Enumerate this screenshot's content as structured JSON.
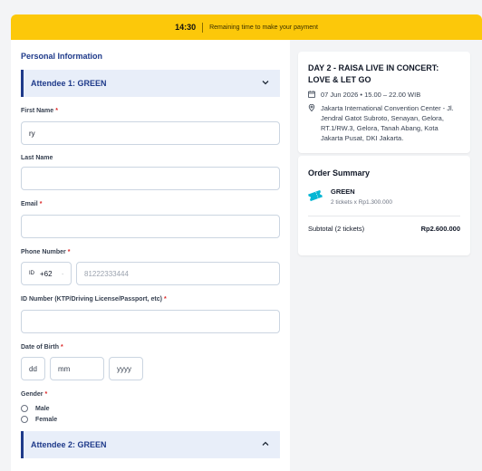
{
  "timer": {
    "time": "14:30",
    "message": "Remaining time to make your payment"
  },
  "form": {
    "section_title": "Personal Information",
    "attendee1": {
      "header": "Attendee 1: GREEN",
      "first_name_label": "First Name",
      "first_name_value": "ry",
      "last_name_label": "Last Name",
      "last_name_value": "",
      "email_label": "Email",
      "email_value": "",
      "phone_label": "Phone Number",
      "phone_flag": "ID",
      "phone_code": "+62",
      "phone_placeholder": "81222333444",
      "id_label": "ID Number (KTP/Driving License/Passport, etc)",
      "dob_label": "Date of Birth",
      "dob_day_placeholder": "dd",
      "dob_month_placeholder": "mm",
      "dob_year_placeholder": "yyyy",
      "gender_label": "Gender",
      "gender_options": [
        "Male",
        "Female"
      ]
    },
    "attendee2": {
      "header": "Attendee 2: GREEN"
    }
  },
  "event": {
    "title": "DAY 2 - RAISA LIVE IN CONCERT: LOVE & LET GO",
    "datetime": "07 Jun 2026 • 15.00 – 22.00 WIB",
    "location": "Jakarta International Convention Center - Jl. Jendral Gatot Subroto, Senayan, Gelora, RT.1/RW.3, Gelora, Tanah Abang, Kota Jakarta Pusat, DKI Jakarta."
  },
  "summary": {
    "title": "Order Summary",
    "ticket_name": "GREEN",
    "ticket_detail": "2 tickets x Rp1.300.000",
    "subtotal_label": "Subtotal (2 tickets)",
    "subtotal_value": "Rp2.600.000"
  },
  "colors": {
    "accent": "#fcc80a",
    "primary": "#1e3a8a",
    "required": "#dc2626",
    "ticket_icon": "#06b6d4"
  },
  "icons": {
    "calendar": "calendar-icon",
    "location": "location-pin-icon",
    "ticket": "ticket-icon",
    "collapse": "chevron-up-icon",
    "expand": "chevron-down-icon"
  }
}
